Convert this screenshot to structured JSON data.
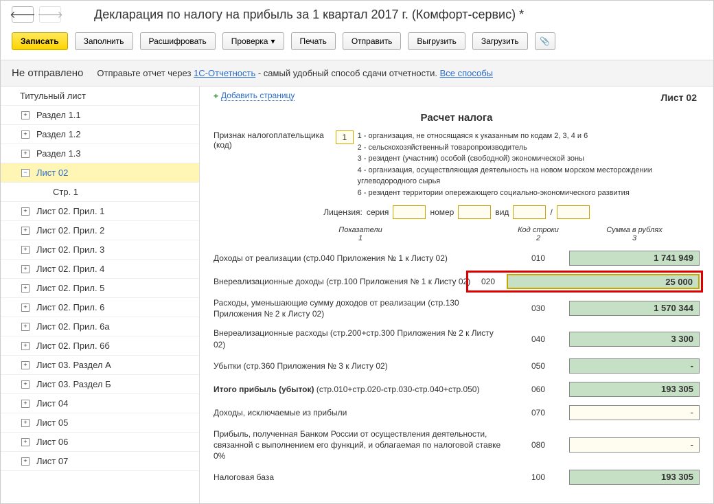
{
  "header": {
    "title": "Декларация по налогу на прибыль за 1 квартал 2017 г. (Комфорт-сервис) *"
  },
  "toolbar": {
    "save": "Записать",
    "fill": "Заполнить",
    "decode": "Расшифровать",
    "check": "Проверка",
    "print": "Печать",
    "send": "Отправить",
    "export": "Выгрузить",
    "import": "Загрузить"
  },
  "status": {
    "label": "Не отправлено",
    "hint_prefix": "Отправьте отчет через ",
    "hint_link": "1С-Отчетность",
    "hint_suffix": " - самый удобный способ сдачи отчетности. ",
    "hint_all": "Все способы"
  },
  "tree": [
    {
      "label": "Титульный лист",
      "level": 0,
      "toggle": ""
    },
    {
      "label": "Раздел 1.1",
      "level": 1,
      "toggle": "+"
    },
    {
      "label": "Раздел 1.2",
      "level": 1,
      "toggle": "+"
    },
    {
      "label": "Раздел 1.3",
      "level": 1,
      "toggle": "+"
    },
    {
      "label": "Лист 02",
      "level": 1,
      "toggle": "−",
      "selected": true
    },
    {
      "label": "Стр. 1",
      "level": 2,
      "toggle": ""
    },
    {
      "label": "Лист 02. Прил. 1",
      "level": 1,
      "toggle": "+"
    },
    {
      "label": "Лист 02. Прил. 2",
      "level": 1,
      "toggle": "+"
    },
    {
      "label": "Лист 02. Прил. 3",
      "level": 1,
      "toggle": "+"
    },
    {
      "label": "Лист 02. Прил. 4",
      "level": 1,
      "toggle": "+"
    },
    {
      "label": "Лист 02. Прил. 5",
      "level": 1,
      "toggle": "+"
    },
    {
      "label": "Лист 02. Прил. 6",
      "level": 1,
      "toggle": "+"
    },
    {
      "label": "Лист 02. Прил. 6а",
      "level": 1,
      "toggle": "+"
    },
    {
      "label": "Лист 02. Прил. 6б",
      "level": 1,
      "toggle": "+"
    },
    {
      "label": "Лист 03. Раздел А",
      "level": 1,
      "toggle": "+"
    },
    {
      "label": "Лист 03. Раздел Б",
      "level": 1,
      "toggle": "+"
    },
    {
      "label": "Лист 04",
      "level": 1,
      "toggle": "+"
    },
    {
      "label": "Лист 05",
      "level": 1,
      "toggle": "+"
    },
    {
      "label": "Лист 06",
      "level": 1,
      "toggle": "+"
    },
    {
      "label": "Лист 07",
      "level": 1,
      "toggle": "+"
    }
  ],
  "content": {
    "add_page": "Добавить страницу",
    "sheet": "Лист 02",
    "calc_title": "Расчет налога",
    "taxpayer_label": "Признак налогоплательщика (код)",
    "taxpayer_code": "1",
    "codes": [
      "1 - организация, не относящаяся к указанным по кодам 2, 3, 4 и 6",
      "2 - сельскохозяйственный товаропроизводитель",
      "3 - резидент (участник) особой (свободной) экономической зоны",
      "4 - организация, осуществляющая деятельность на новом морском месторождении углеводородного сырья",
      "6 - резидент территории опережающего социально-экономического развития"
    ],
    "license": {
      "label": "Лицензия:",
      "series": "серия",
      "number": "номер",
      "type": "вид",
      "slash": "/"
    },
    "cols": {
      "c1a": "Показатели",
      "c1b": "1",
      "c2a": "Код строки",
      "c2b": "2",
      "c3a": "Сумма в рублях",
      "c3b": "3"
    },
    "rows": [
      {
        "label": "Доходы от реализации (стр.040 Приложения № 1 к Листу 02)",
        "code": "010",
        "value": "1 741 949",
        "cls": ""
      },
      {
        "label": "Внереализационные доходы (стр.100 Приложения № 1 к Листу 02)",
        "code": "020",
        "value": "25 000",
        "highlight": true
      },
      {
        "label": "Расходы, уменьшающие сумму доходов от реализации (стр.130 Приложения № 2 к Листу 02)",
        "code": "030",
        "value": "1 570 344",
        "cls": ""
      },
      {
        "label": "Внереализационные расходы (стр.200+стр.300 Приложения № 2 к Листу 02)",
        "code": "040",
        "value": "3 300",
        "cls": ""
      },
      {
        "label": "Убытки (стр.360 Приложения № 3 к Листу 02)",
        "code": "050",
        "value": "",
        "cls": "dash"
      },
      {
        "label_bold": "Итого прибыль (убыток)",
        "label_rest": "  (стр.010+стр.020-стр.030-стр.040+стр.050)",
        "code": "060",
        "value": "193 305",
        "cls": ""
      },
      {
        "label": "Доходы, исключаемые из прибыли",
        "code": "070",
        "value": "",
        "cls": "empty dash"
      },
      {
        "label": "Прибыль, полученная Банком России от осуществления деятельности, связанной с выполнением его функций, и облагаемая по налоговой ставке 0%",
        "code": "080",
        "value": "",
        "cls": "empty dash"
      },
      {
        "label": "Налоговая база",
        "code": "100",
        "value": "193 305",
        "cls": ""
      }
    ]
  }
}
